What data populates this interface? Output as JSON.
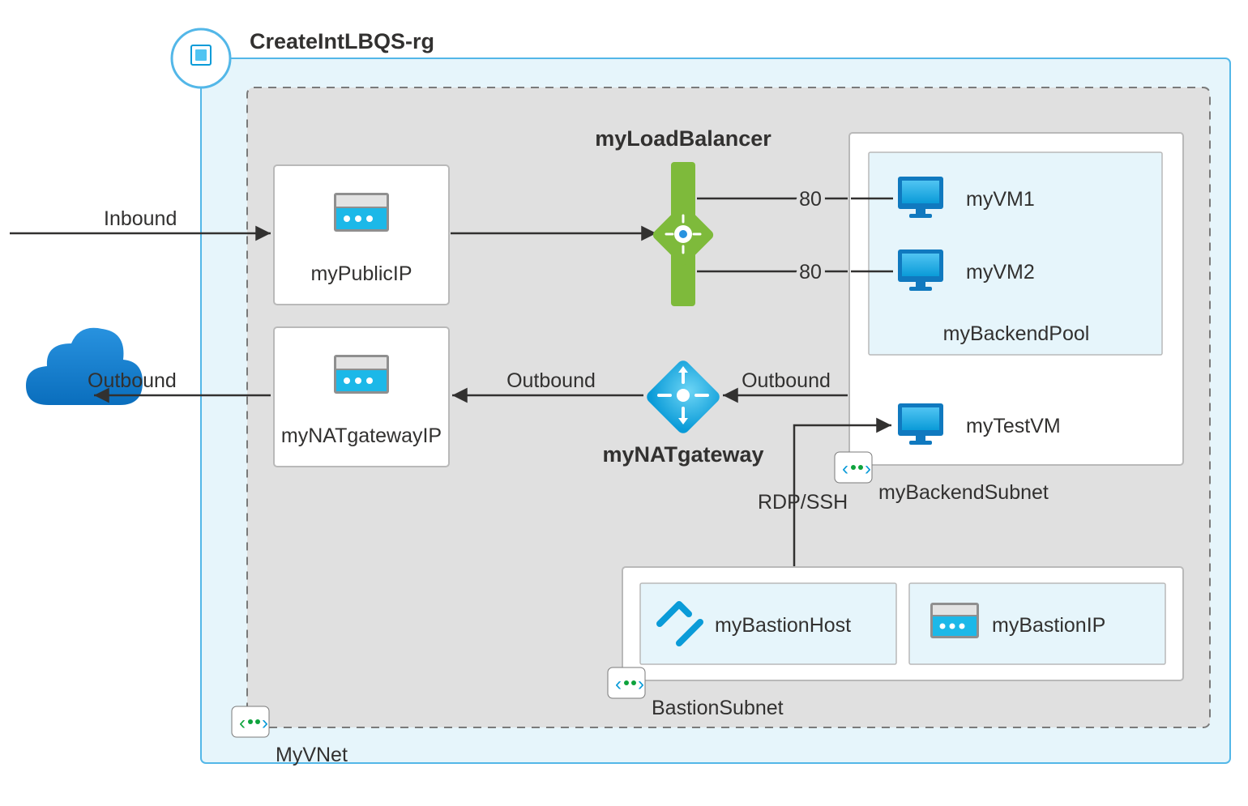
{
  "diagram": {
    "resource_group": "CreateIntLBQS-rg",
    "vnet": "MyVNet",
    "edges": {
      "inbound": "Inbound",
      "outbound_left": "Outbound",
      "outbound_mid_left": "Outbound",
      "outbound_mid_right": "Outbound",
      "port80_top": "80",
      "port80_bottom": "80",
      "rdp_ssh": "RDP/SSH"
    },
    "lb": "myLoadBalancer",
    "nat": "myNATgateway",
    "backend_subnet": "myBackendSubnet",
    "backend_pool": "myBackendPool",
    "bastion_subnet": "BastionSubnet",
    "nodes": {
      "public_ip": "myPublicIP",
      "nat_gw_ip": "myNATgatewayIP",
      "vm1": "myVM1",
      "vm2": "myVM2",
      "test_vm": "myTestVM",
      "bastion_host": "myBastionHost",
      "bastion_ip": "myBastionIP"
    }
  }
}
